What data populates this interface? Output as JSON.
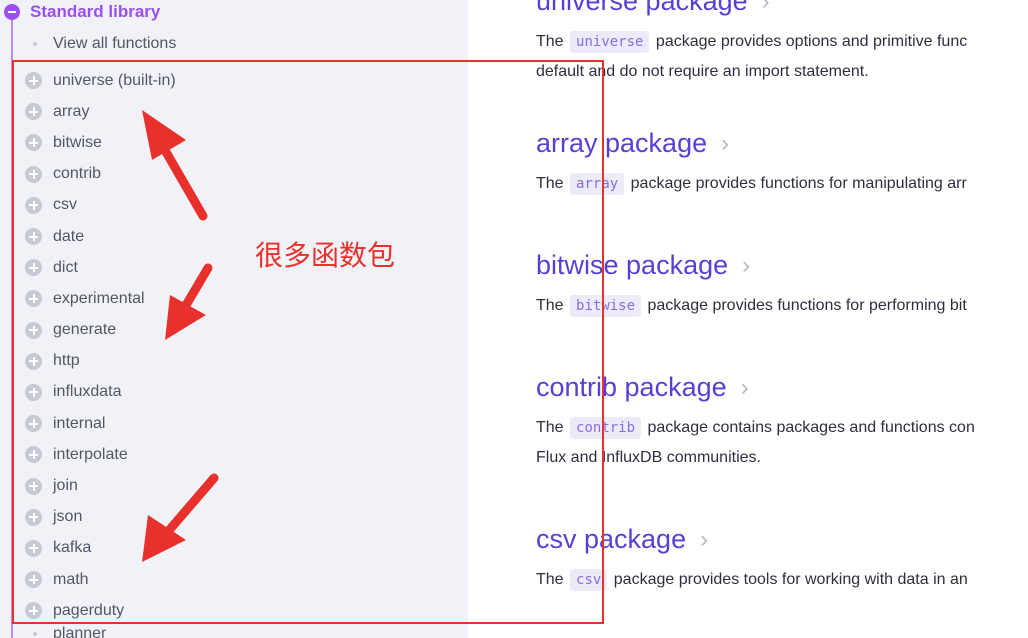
{
  "sidebar": {
    "section_label": "Standard library",
    "view_all": "View all functions",
    "packages": [
      "universe (built-in)",
      "array",
      "bitwise",
      "contrib",
      "csv",
      "date",
      "dict",
      "experimental",
      "generate",
      "http",
      "influxdata",
      "internal",
      "interpolate",
      "join",
      "json",
      "kafka",
      "math",
      "pagerduty"
    ],
    "partial_item": "planner"
  },
  "content": {
    "sections": [
      {
        "title": "universe package",
        "code": "universe",
        "pre": "The",
        "post": "package provides options and primitive func",
        "line2": "default and do not require an import statement."
      },
      {
        "title": "array package",
        "code": "array",
        "pre": "The",
        "post": "package provides functions for manipulating arr",
        "line2": ""
      },
      {
        "title": "bitwise package",
        "code": "bitwise",
        "pre": "The",
        "post": "package provides functions for performing bit",
        "line2": ""
      },
      {
        "title": "contrib package",
        "code": "contrib",
        "pre": "The",
        "post": "package contains packages and functions con",
        "line2": "Flux and InfluxDB communities."
      },
      {
        "title": "csv package",
        "code": "csv",
        "pre": "The",
        "post": "package provides tools for working with data in an",
        "line2": ""
      }
    ]
  },
  "annotation": {
    "text": "很多函数包",
    "color": "#e8312c"
  },
  "colors": {
    "accent": "#9b4ff0",
    "link": "#5a3fd6",
    "sidebar_bg": "#f1f2f7"
  }
}
